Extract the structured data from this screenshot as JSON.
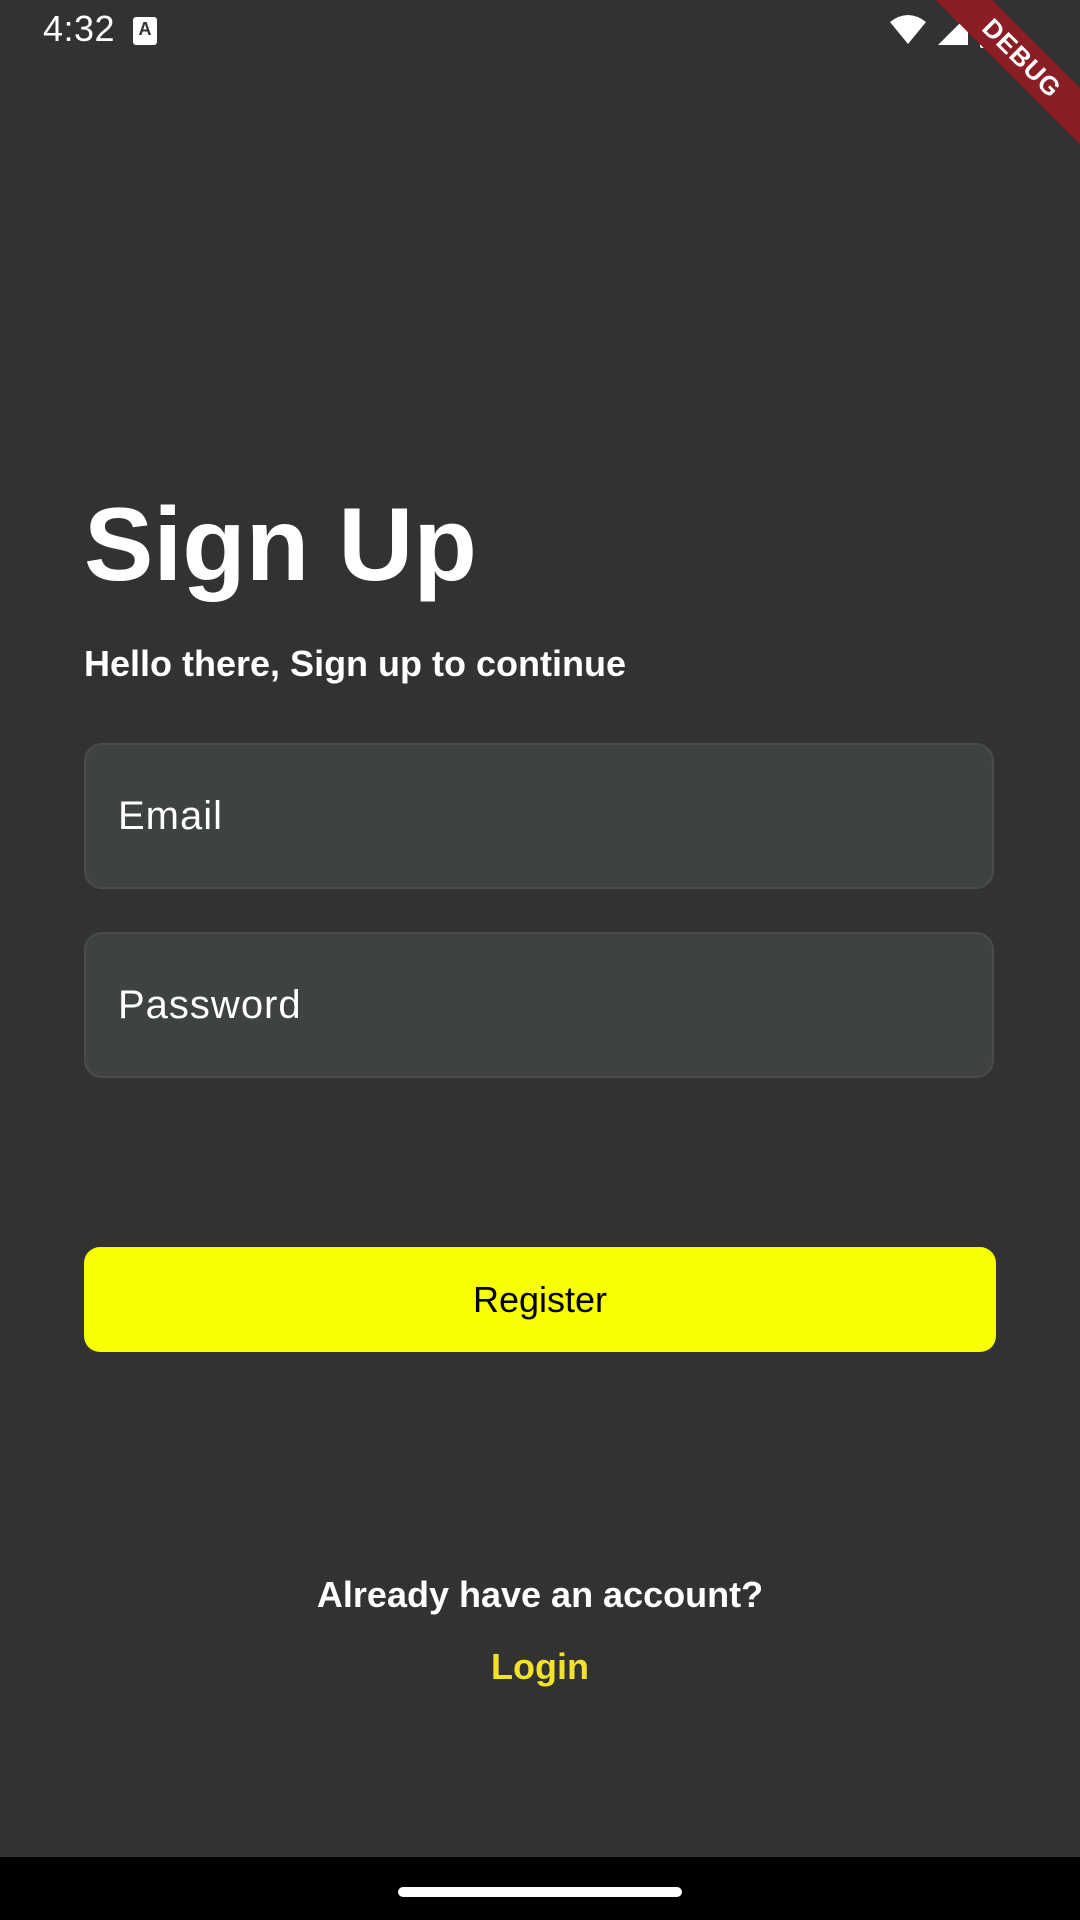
{
  "status_bar": {
    "time": "4:32",
    "notification_icon": "a-icon",
    "wifi_icon": "wifi-icon",
    "signal_icon": "signal-icon",
    "battery_icon": "battery-icon"
  },
  "debug_banner": {
    "label": "DEBUG",
    "color": "#8b1d24"
  },
  "signup": {
    "title": "Sign Up",
    "subtitle": "Hello there, Sign up to continue",
    "email_placeholder": "Email",
    "password_placeholder": "Password",
    "register_label": "Register",
    "account_prompt": "Already have an account?",
    "login_label": "Login"
  },
  "colors": {
    "background": "#323232",
    "field_fill": "#3f4340",
    "accent_button": "#f8ff00",
    "link": "#f2e22a"
  }
}
